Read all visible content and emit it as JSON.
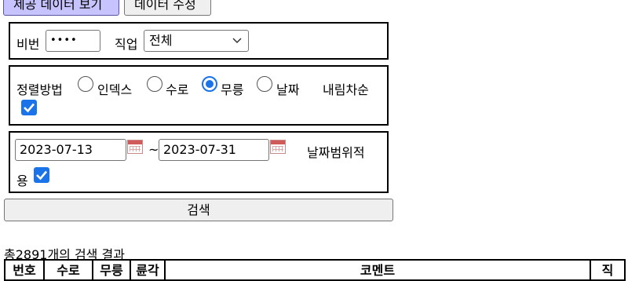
{
  "tabs": {
    "view_label": "제공 데이터 보기",
    "edit_label": "데이터 수정"
  },
  "filters": {
    "password_label": "비번",
    "password_value": "••••",
    "job_label": "직업",
    "job_selected": "전체",
    "sort_label": "정렬방법",
    "sort_options": [
      "인덱스",
      "수로",
      "무릉",
      "날짜"
    ],
    "sort_selected": "무릉",
    "descending_label": "내림차순",
    "descending_checked": true,
    "date_from": "2023-07-13",
    "date_separator": "~",
    "date_to": "2023-07-31",
    "date_range_label_1": "날짜범위적",
    "date_range_label_2": "용",
    "date_range_checked": true
  },
  "search": {
    "button_label": "검색",
    "result_count_text": "총2891개의 검색 결과"
  },
  "table": {
    "columns": [
      "번호",
      "수로",
      "무릉",
      "륜각",
      "코멘트",
      "직"
    ]
  },
  "colors": {
    "active_tab": "#c7c3ff",
    "control_accent": "#1a73e8"
  }
}
